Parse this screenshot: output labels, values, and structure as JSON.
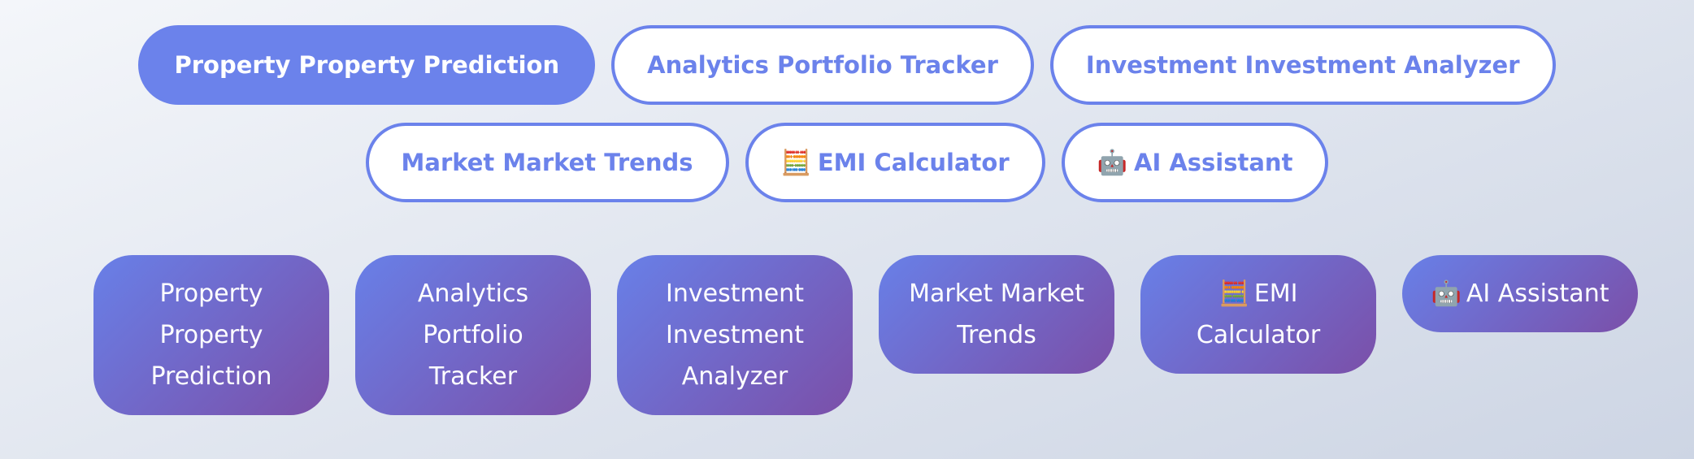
{
  "tabs": [
    {
      "label": "Property Property Prediction",
      "icon": "",
      "active": true
    },
    {
      "label": "Analytics Portfolio Tracker",
      "icon": "",
      "active": false
    },
    {
      "label": "Investment Investment Analyzer",
      "icon": "",
      "active": false
    },
    {
      "label": "Market Market Trends",
      "icon": "",
      "active": false
    },
    {
      "label": "EMI Calculator",
      "icon": "🧮",
      "active": false
    },
    {
      "label": "AI Assistant",
      "icon": "🤖",
      "active": false
    }
  ],
  "cards": [
    {
      "label": "Property Property Prediction",
      "icon": ""
    },
    {
      "label": "Analytics Portfolio Tracker",
      "icon": ""
    },
    {
      "label": "Investment Investment Analyzer",
      "icon": ""
    },
    {
      "label": "Market Market Trends",
      "icon": ""
    },
    {
      "label": "EMI Calculator",
      "icon": "🧮"
    },
    {
      "label": "AI Assistant",
      "icon": "🤖"
    }
  ],
  "colors": {
    "accent": "#6b82eb",
    "card_gradient_start": "#6880e8",
    "card_gradient_end": "#7b4fa8"
  }
}
